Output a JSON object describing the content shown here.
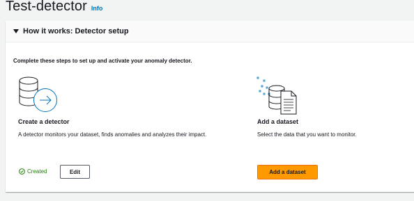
{
  "header": {
    "title": "Test-detector",
    "info_link": "Info"
  },
  "panel": {
    "title": "How it works: Detector setup",
    "intro": "Complete these steps to set up and activate your anomaly detector.",
    "steps": [
      {
        "title": "Create a detector",
        "description": "A detector monitors your dataset, finds anomalies and analyzes their impact.",
        "icon": "database-arrow-icon",
        "status": "Created",
        "status_icon": "check-circle-icon",
        "button_label": "Edit"
      },
      {
        "title": "Add a dataset",
        "description": "Select the data that you want to monitor.",
        "icon": "database-document-icon",
        "button_label": "Add a dataset"
      }
    ]
  },
  "colors": {
    "accent": "#ff9900",
    "link": "#0073bb",
    "success": "#1d8102",
    "background": "#f2f3f3"
  }
}
